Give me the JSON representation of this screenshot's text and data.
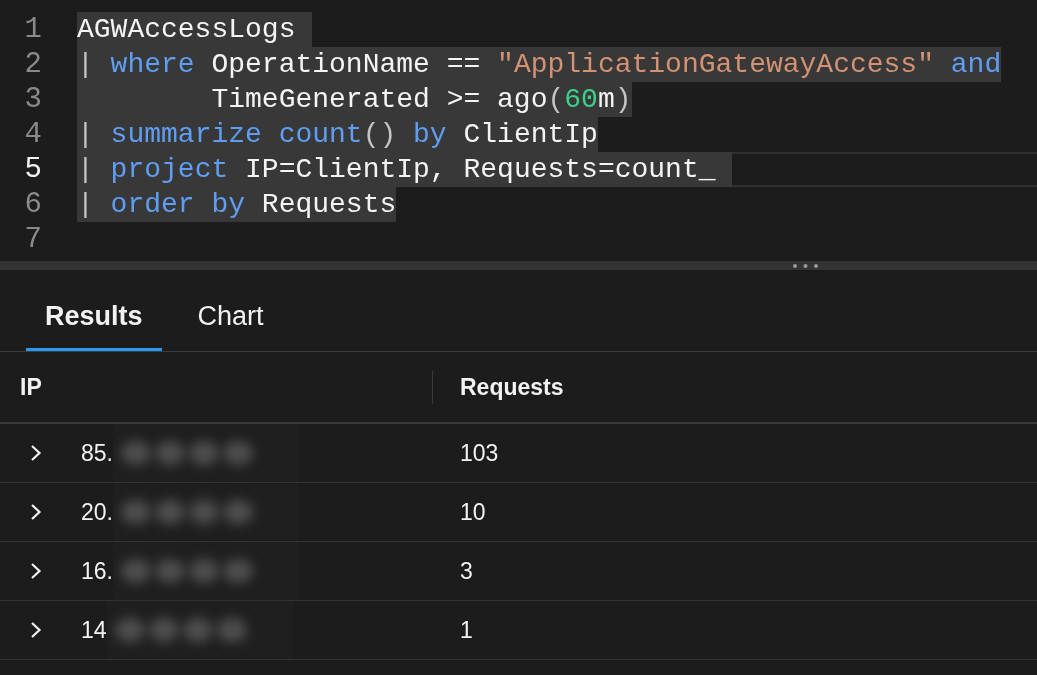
{
  "editor": {
    "lines": [
      {
        "number": "1",
        "current": false,
        "selected": true,
        "tokens": [
          {
            "kind": "plain",
            "text": "AGWAccessLogs "
          }
        ]
      },
      {
        "number": "2",
        "current": false,
        "selected": true,
        "tokens": [
          {
            "kind": "punctuation",
            "text": "|"
          },
          {
            "kind": "keyword",
            "text": " where"
          },
          {
            "kind": "plain",
            "text": " OperationName == "
          },
          {
            "kind": "string",
            "text": "\"ApplicationGatewayAccess\""
          },
          {
            "kind": "keyword",
            "text": " and"
          }
        ]
      },
      {
        "number": "3",
        "current": false,
        "selected": true,
        "tokens": [
          {
            "kind": "plain",
            "text": "        TimeGenerated >= ago"
          },
          {
            "kind": "punctuation",
            "text": "("
          },
          {
            "kind": "number",
            "text": "60"
          },
          {
            "kind": "plain",
            "text": "m"
          },
          {
            "kind": "punctuation",
            "text": ")"
          }
        ]
      },
      {
        "number": "4",
        "current": false,
        "selected": true,
        "tokens": [
          {
            "kind": "punctuation",
            "text": "|"
          },
          {
            "kind": "keyword",
            "text": " summarize count"
          },
          {
            "kind": "punctuation",
            "text": "()"
          },
          {
            "kind": "keyword",
            "text": " by"
          },
          {
            "kind": "plain",
            "text": " ClientIp"
          }
        ]
      },
      {
        "number": "5",
        "current": true,
        "selected": true,
        "tokens": [
          {
            "kind": "punctuation",
            "text": "|"
          },
          {
            "kind": "keyword",
            "text": " project"
          },
          {
            "kind": "plain",
            "text": " IP=ClientIp, Requests=count_ "
          }
        ]
      },
      {
        "number": "6",
        "current": false,
        "selected": true,
        "tokens": [
          {
            "kind": "punctuation",
            "text": "|"
          },
          {
            "kind": "keyword",
            "text": " order by"
          },
          {
            "kind": "plain",
            "text": " Requests"
          }
        ]
      },
      {
        "number": "7",
        "current": false,
        "selected": false
      }
    ]
  },
  "result_tabs": [
    {
      "label": "Results",
      "selected": true
    },
    {
      "label": "Chart",
      "selected": false
    }
  ],
  "table": {
    "columns": [
      "IP",
      "Requests"
    ],
    "rows": [
      {
        "expanded": false,
        "ip": "85.",
        "redacted": true,
        "requests": "103"
      },
      {
        "expanded": false,
        "ip": "20.",
        "redacted": true,
        "requests": "10"
      },
      {
        "expanded": false,
        "ip": "16.",
        "redacted": true,
        "requests": "3"
      },
      {
        "expanded": false,
        "ip": "14",
        "redacted": true,
        "requests": "1"
      }
    ]
  }
}
